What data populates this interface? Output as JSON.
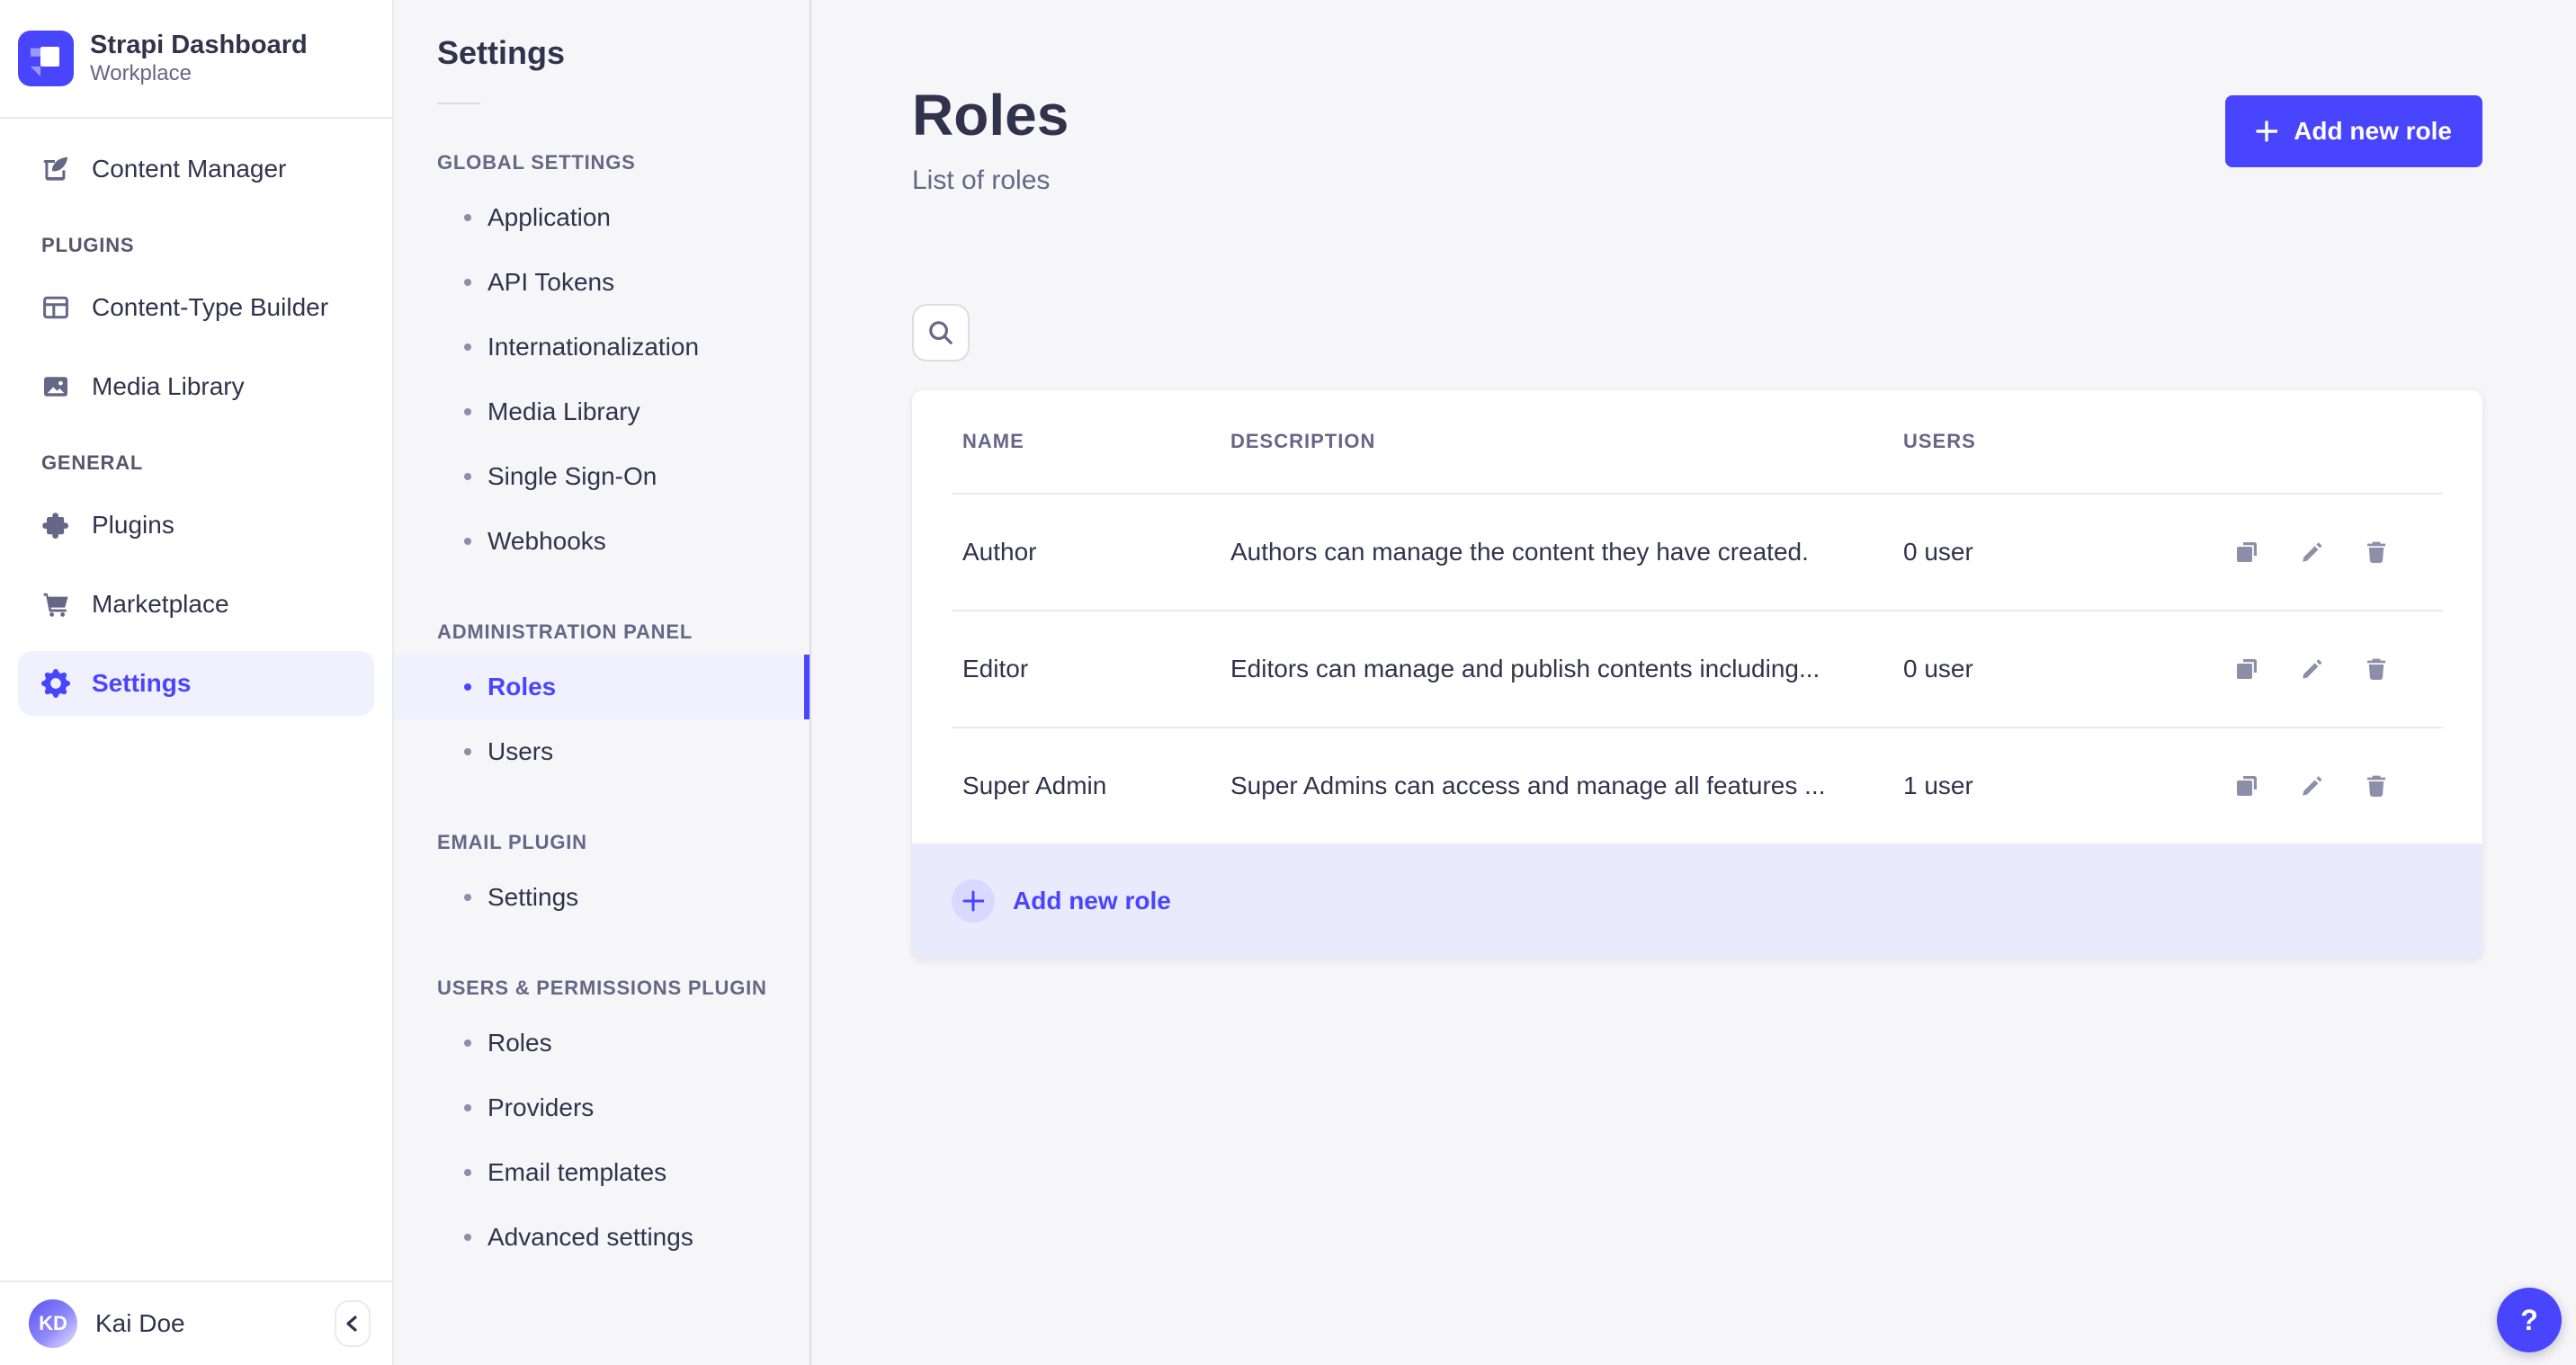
{
  "sidebar": {
    "brand": {
      "title": "Strapi Dashboard",
      "subtitle": "Workplace"
    },
    "primary_item": "Content Manager",
    "sections": [
      {
        "label": "PLUGINS",
        "items": [
          "Content-Type Builder",
          "Media Library"
        ]
      },
      {
        "label": "GENERAL",
        "items": [
          "Plugins",
          "Marketplace",
          "Settings"
        ]
      }
    ],
    "active_item": "Settings",
    "user": {
      "initials": "KD",
      "name": "Kai Doe"
    }
  },
  "subnav": {
    "title": "Settings",
    "sections": [
      {
        "label": "GLOBAL SETTINGS",
        "items": [
          "Application",
          "API Tokens",
          "Internationalization",
          "Media Library",
          "Single Sign-On",
          "Webhooks"
        ]
      },
      {
        "label": "ADMINISTRATION PANEL",
        "items": [
          "Roles",
          "Users"
        ]
      },
      {
        "label": "EMAIL PLUGIN",
        "items": [
          "Settings"
        ]
      },
      {
        "label": "USERS & PERMISSIONS PLUGIN",
        "items": [
          "Roles",
          "Providers",
          "Email templates",
          "Advanced settings"
        ]
      }
    ],
    "active_item": "Roles"
  },
  "main": {
    "title": "Roles",
    "subtitle": "List of roles",
    "add_button_label": "Add new role",
    "table": {
      "headers": [
        "NAME",
        "DESCRIPTION",
        "USERS"
      ],
      "rows": [
        {
          "name": "Author",
          "description": "Authors can manage the content they have created.",
          "users": "0 user"
        },
        {
          "name": "Editor",
          "description": "Editors can manage and publish contents including...",
          "users": "0 user"
        },
        {
          "name": "Super Admin",
          "description": "Super Admins can access and manage all features ...",
          "users": "1 user"
        }
      ],
      "footer_add_label": "Add new role"
    },
    "help_label": "?"
  },
  "colors": {
    "accent": "#4945ff",
    "accent_light_bg": "#f0f0ff",
    "footer_row_bg": "#eaeafd",
    "text_primary": "#32324d",
    "text_secondary": "#666687",
    "icon_gray": "#8e8ea9",
    "border": "#eaeaef",
    "page_bg": "#f6f6f9"
  }
}
